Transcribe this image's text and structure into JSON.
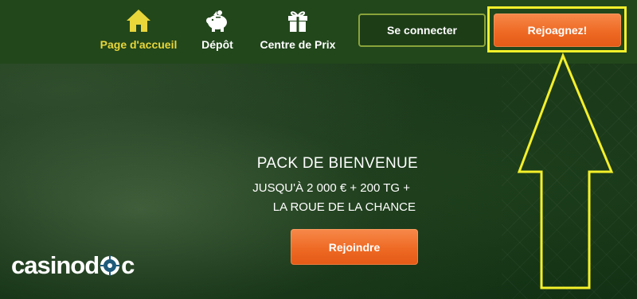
{
  "nav": {
    "items": [
      {
        "label": "Page d'accueil",
        "icon": "home-icon",
        "active": true
      },
      {
        "label": "Dépôt",
        "icon": "piggy-bank-icon",
        "active": false
      },
      {
        "label": "Centre de Prix",
        "icon": "gift-icon",
        "active": false
      }
    ],
    "login_label": "Se connecter",
    "signup_label": "Rejoagnez!"
  },
  "promo": {
    "title": "PACK DE BIENVENUE",
    "line1": "JUSQU'À 2 000 € + 200 TG +",
    "line2": "LA ROUE DE LA CHANCE",
    "cta_label": "Rejoindre"
  },
  "watermark": {
    "text_start": "casinod",
    "text_end": "c"
  },
  "colors": {
    "nav_bg": "#22471b",
    "active_nav": "#e8d63a",
    "orange": "#ee6a24",
    "highlight": "#f4f02a"
  }
}
